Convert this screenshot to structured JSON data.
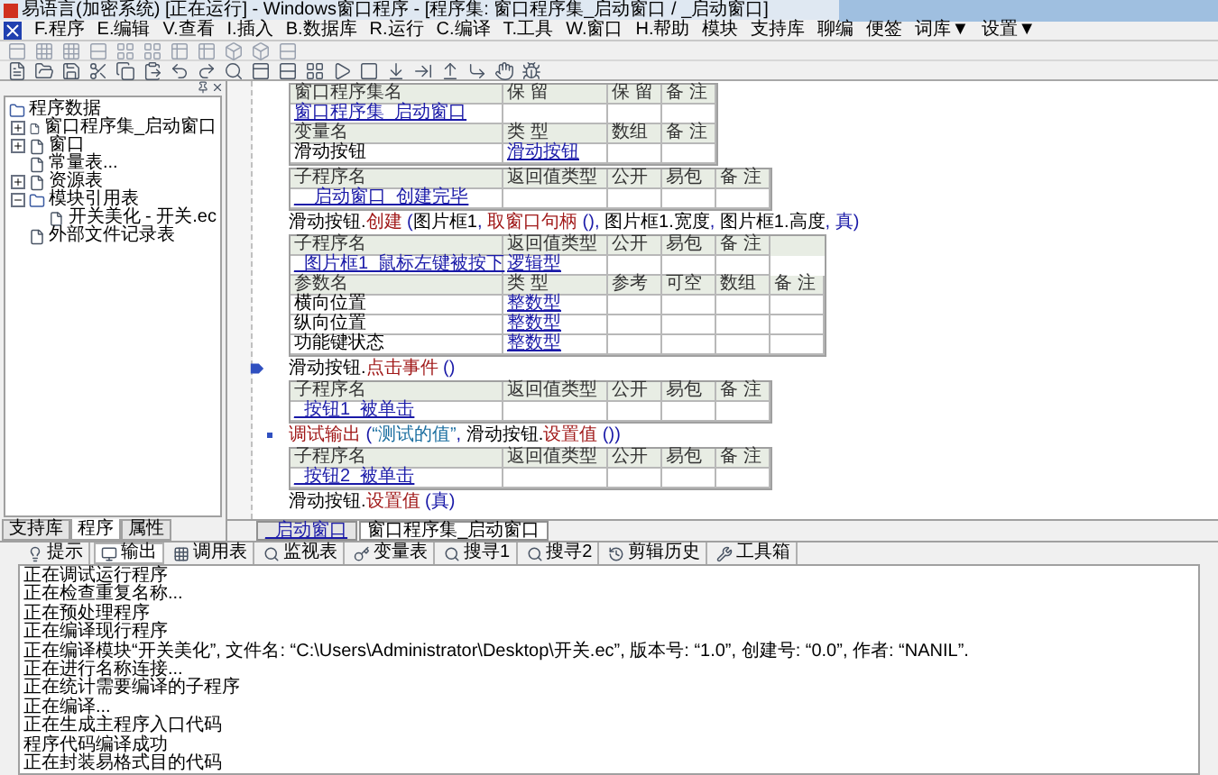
{
  "window": {
    "title": "易语言(加密系统) [正在运行] - Windows窗口程序 - [程序集: 窗口程序集_启动窗口 / _启动窗口]"
  },
  "menu": [
    "F.程序",
    "E.编辑",
    "V.查看",
    "I.插入",
    "B.数据库",
    "R.运行",
    "C.编译",
    "T.工具",
    "W.窗口",
    "H.帮助",
    "模块",
    "支持库",
    "聊编",
    "便签",
    "词库▼",
    "设置▼"
  ],
  "tree": {
    "label": "程序数据",
    "children": [
      {
        "label": "窗口程序集_启动窗口",
        "expanded": false
      },
      {
        "label": "窗口",
        "expanded": false
      },
      {
        "label": "常量表..."
      },
      {
        "label": "资源表",
        "expanded": false
      },
      {
        "label": "模块引用表",
        "expanded": true,
        "children": [
          {
            "label": "开关美化 - 开关.ec"
          }
        ]
      },
      {
        "label": "外部文件记录表"
      }
    ]
  },
  "left_tabs": [
    {
      "label": "支持库",
      "selected": false
    },
    {
      "label": "程序",
      "selected": true
    },
    {
      "label": "属性",
      "selected": false
    }
  ],
  "code": [
    {
      "kind": "table",
      "rows": [
        {
          "kind": "header",
          "cells": [
            "窗口程序集名",
            "保 留",
            "保 留",
            "备 注"
          ]
        },
        {
          "kind": "sub",
          "cells": [
            "窗口程序集_启动窗口",
            "",
            "",
            ""
          ]
        },
        {
          "kind": "header",
          "cells": [
            "变量名",
            "类 型",
            "数组",
            "备 注"
          ]
        },
        {
          "kind": "var",
          "cells": [
            "滑动按钮",
            "滑动按钮",
            "",
            ""
          ]
        }
      ]
    },
    {
      "kind": "table",
      "rows": [
        {
          "kind": "header",
          "cells": [
            "子程序名",
            "返回值类型",
            "公开",
            "易包",
            "备 注"
          ]
        },
        {
          "kind": "sub",
          "cells": [
            "__启动窗口_创建完毕",
            "",
            "",
            "",
            ""
          ]
        }
      ]
    },
    {
      "kind": "line",
      "current": false,
      "bullet": false,
      "segments": [
        {
          "kind": "name",
          "text": "滑动按钮."
        },
        {
          "kind": "command",
          "text": "创建"
        },
        {
          "kind": "punct",
          "text": " ("
        },
        {
          "kind": "name",
          "text": "图片框1"
        },
        {
          "kind": "punct",
          "text": ", "
        },
        {
          "kind": "command",
          "text": "取窗口句柄"
        },
        {
          "kind": "punct",
          "text": " (), "
        },
        {
          "kind": "name",
          "text": "图片框1.宽度"
        },
        {
          "kind": "punct",
          "text": ", "
        },
        {
          "kind": "name",
          "text": "图片框1.高度"
        },
        {
          "kind": "punct",
          "text": ", 真)"
        }
      ]
    },
    {
      "kind": "table",
      "rows": [
        {
          "kind": "header",
          "cells": [
            "子程序名",
            "返回值类型",
            "公开",
            "易包",
            "备 注"
          ]
        },
        {
          "kind": "sub",
          "cells": [
            "_图片框1_鼠标左键被按下",
            "逻辑型",
            "",
            "",
            ""
          ]
        },
        {
          "kind": "header",
          "cells": [
            "参数名",
            "类 型",
            "参考",
            "可空",
            "数组",
            "备 注"
          ]
        },
        {
          "kind": "var",
          "cells": [
            "横向位置",
            "整数型",
            "",
            "",
            "",
            ""
          ]
        },
        {
          "kind": "var",
          "cells": [
            "纵向位置",
            "整数型",
            "",
            "",
            "",
            ""
          ]
        },
        {
          "kind": "var",
          "cells": [
            "功能键状态",
            "整数型",
            "",
            "",
            "",
            ""
          ]
        }
      ]
    },
    {
      "kind": "line",
      "current": true,
      "bullet": false,
      "segments": [
        {
          "kind": "name",
          "text": "滑动按钮."
        },
        {
          "kind": "command",
          "text": "点击事件"
        },
        {
          "kind": "punct",
          "text": " ()"
        }
      ]
    },
    {
      "kind": "table",
      "rows": [
        {
          "kind": "header",
          "cells": [
            "子程序名",
            "返回值类型",
            "公开",
            "易包",
            "备 注"
          ]
        },
        {
          "kind": "sub",
          "cells": [
            "_按钮1_被单击",
            "",
            "",
            "",
            ""
          ]
        }
      ]
    },
    {
      "kind": "line",
      "current": false,
      "bullet": true,
      "segments": [
        {
          "kind": "command",
          "text": "调试输出"
        },
        {
          "kind": "punct",
          "text": " ("
        },
        {
          "kind": "string",
          "text": "“测试的值”"
        },
        {
          "kind": "punct",
          "text": ", "
        },
        {
          "kind": "name",
          "text": "滑动按钮."
        },
        {
          "kind": "command",
          "text": "设置值"
        },
        {
          "kind": "punct",
          "text": " ())"
        }
      ]
    },
    {
      "kind": "table",
      "rows": [
        {
          "kind": "header",
          "cells": [
            "子程序名",
            "返回值类型",
            "公开",
            "易包",
            "备 注"
          ]
        },
        {
          "kind": "sub",
          "cells": [
            "_按钮2_被单击",
            "",
            "",
            "",
            ""
          ]
        }
      ]
    },
    {
      "kind": "line",
      "current": false,
      "bullet": false,
      "segments": [
        {
          "kind": "name",
          "text": "滑动按钮."
        },
        {
          "kind": "command",
          "text": "设置值"
        },
        {
          "kind": "punct",
          "text": " (真)"
        }
      ]
    }
  ],
  "editor_tabs": [
    {
      "label": "_启动窗口",
      "selected": false
    },
    {
      "label": "窗口程序集_启动窗口",
      "selected": true
    }
  ],
  "output_tabs": [
    {
      "label": "提示",
      "selected": false
    },
    {
      "label": "输出",
      "selected": true
    },
    {
      "label": "调用表",
      "selected": false
    },
    {
      "label": "监视表",
      "selected": false
    },
    {
      "label": "变量表",
      "selected": false
    },
    {
      "label": "搜寻1",
      "selected": false
    },
    {
      "label": "搜寻2",
      "selected": false
    },
    {
      "label": "剪辑历史",
      "selected": false
    },
    {
      "label": "工具箱",
      "selected": false
    }
  ],
  "output_lines": [
    "正在调试运行程序",
    "正在检查重复名称...",
    "正在预处理程序",
    "正在编译现行程序",
    "正在编译模块“开关美化”, 文件名: “C:\\Users\\Administrator\\Desktop\\开关.ec”, 版本号: “1.0”, 创建号: “0.0”, 作者: “NANIL”.",
    "正在进行名称连接...",
    "正在统计需要编译的子程序",
    "正在编译...",
    "正在生成主程序入口代码",
    "程序代码编译成功",
    "正在封装易格式目的代码"
  ]
}
